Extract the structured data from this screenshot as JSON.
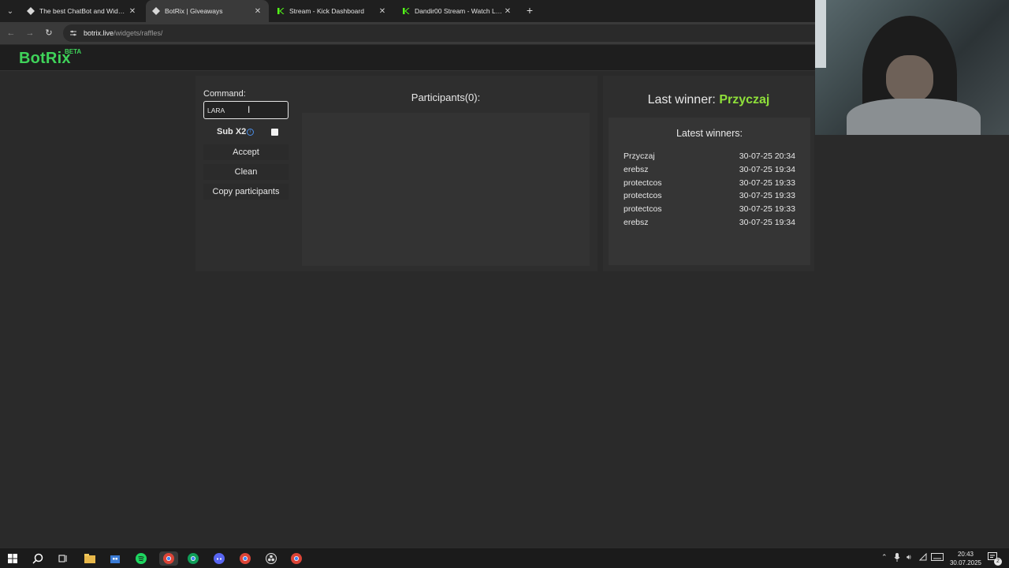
{
  "browser": {
    "tabs": [
      {
        "title": "The best ChatBot and Widgets f",
        "active": false
      },
      {
        "title": "BotRix | Giveaways",
        "active": true
      },
      {
        "title": "Stream - Kick Dashboard",
        "active": false
      },
      {
        "title": "Dandir00 Stream - Watch Live o",
        "active": false
      }
    ],
    "url_host": "botrix.live",
    "url_path": "/widgets/raffles/"
  },
  "site": {
    "logo": "BotRix",
    "badge": "BETA"
  },
  "raffle": {
    "command_label": "Command:",
    "command_value": "LARA",
    "sub_label": "Sub X2",
    "sub_checked": false,
    "accept_label": "Accept",
    "clean_label": "Clean",
    "copy_label": "Copy participants",
    "participants_title": "Participants(0):"
  },
  "winners": {
    "last_winner_label": "Last winner:",
    "last_winner_name": "Przyczaj",
    "latest_title": "Latest winners:",
    "list": [
      {
        "name": "Przyczaj",
        "time": "30-07-25 20:34"
      },
      {
        "name": "erebsz",
        "time": "30-07-25 19:34"
      },
      {
        "name": "protectcos",
        "time": "30-07-25 19:33"
      },
      {
        "name": "protectcos",
        "time": "30-07-25 19:33"
      },
      {
        "name": "protectcos",
        "time": "30-07-25 19:33"
      },
      {
        "name": "erebsz",
        "time": "30-07-25 19:34"
      }
    ]
  },
  "taskbar": {
    "time": "20:43",
    "date": "30.07.2025",
    "notifications": "2"
  },
  "colors": {
    "brand_green": "#3fd35a",
    "winner_green": "#8fe03a",
    "info_blue": "#4a8ee8"
  }
}
